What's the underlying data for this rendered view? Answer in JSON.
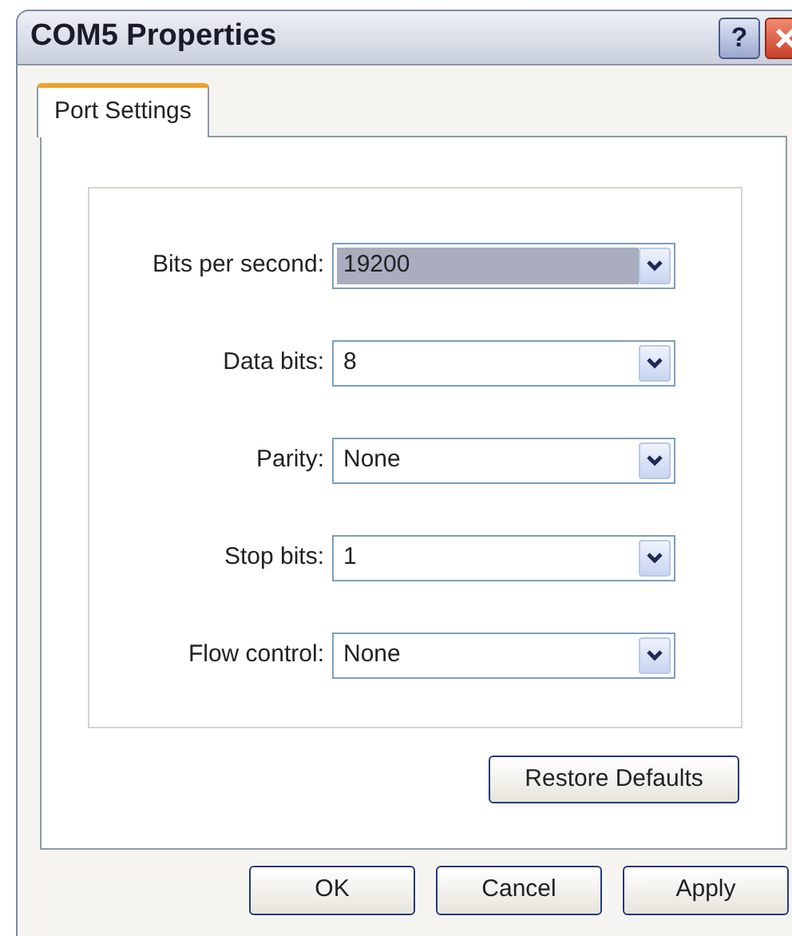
{
  "window": {
    "title": "COM5 Properties",
    "help_button": "?"
  },
  "tabs": [
    {
      "label": "Port Settings",
      "selected": true
    }
  ],
  "fields": [
    {
      "label": "Bits per second:",
      "value": "19200",
      "highlighted": true
    },
    {
      "label": "Data bits:",
      "value": "8",
      "highlighted": false
    },
    {
      "label": "Parity:",
      "value": "None",
      "highlighted": false
    },
    {
      "label": "Stop bits:",
      "value": "1",
      "highlighted": false
    },
    {
      "label": "Flow control:",
      "value": "None",
      "highlighted": false
    }
  ],
  "restore_button": "Restore Defaults",
  "buttons": [
    "OK",
    "Cancel",
    "Apply"
  ]
}
